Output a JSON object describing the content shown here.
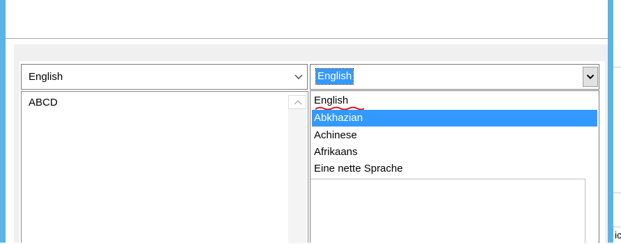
{
  "source_combo": {
    "value": "English",
    "icon": "chevron-down-icon"
  },
  "source_list": {
    "items": [
      "ABCD"
    ]
  },
  "target_combo": {
    "value": "English",
    "icon": "dropdown-arrow-icon"
  },
  "target_dropdown": {
    "options": [
      "English",
      "Abkhazian",
      "Achinese",
      "Afrikaans",
      "Eine nette Sprache"
    ],
    "highlighted": "Abkhazian",
    "spellcheck_marked": "English"
  },
  "edge_fragment": {
    "text": "ic"
  },
  "colors": {
    "accent": "#5bb4e6",
    "selection": "#3399ff",
    "spellcheck_underline": "#e0101a"
  }
}
